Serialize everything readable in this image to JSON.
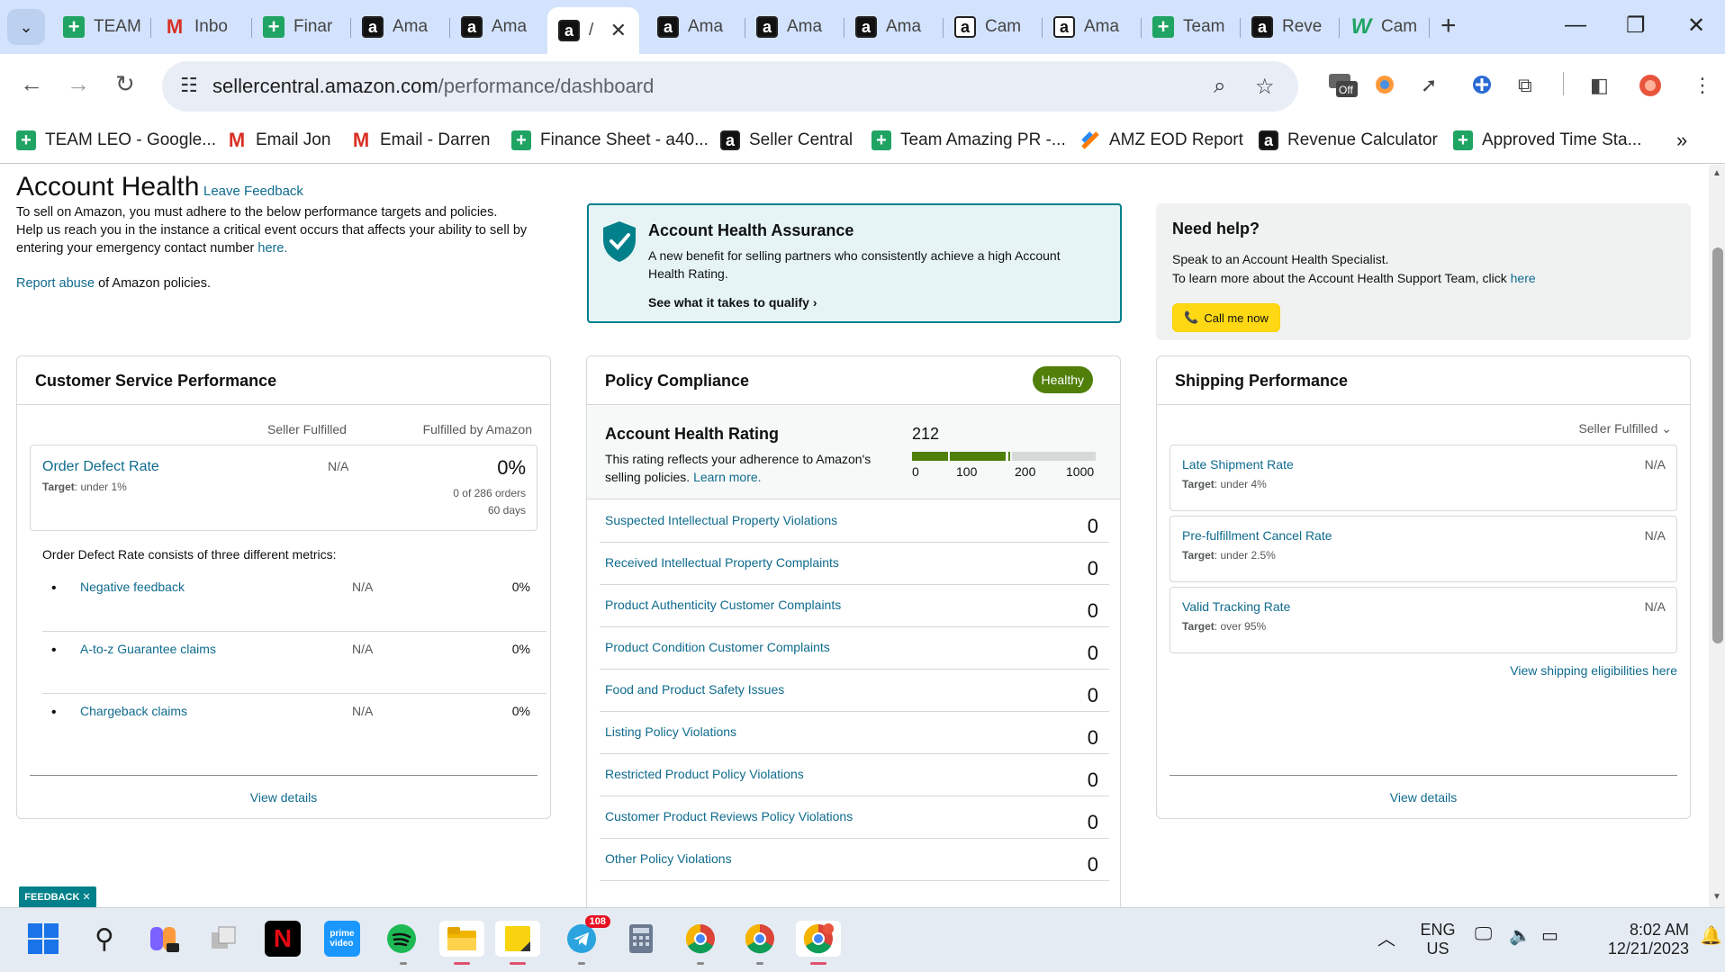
{
  "tabs": [
    {
      "label": "TEAM",
      "icon": "sheets-icon"
    },
    {
      "label": "Inbo",
      "icon": "gmail-icon"
    },
    {
      "label": "Finar",
      "icon": "sheets-icon"
    },
    {
      "label": "Ama",
      "icon": "amazon-icon"
    },
    {
      "label": "Ama",
      "icon": "amazon-icon"
    },
    {
      "label": "/",
      "icon": "amazon-icon",
      "active": true
    },
    {
      "label": "Ama",
      "icon": "amazon-icon"
    },
    {
      "label": "Ama",
      "icon": "amazon-icon"
    },
    {
      "label": "Ama",
      "icon": "amazon-icon"
    },
    {
      "label": "Cam",
      "icon": "amazon-icon"
    },
    {
      "label": "Ama",
      "icon": "amazon-icon"
    },
    {
      "label": "Team",
      "icon": "sheets-icon"
    },
    {
      "label": "Reve",
      "icon": "amazon-icon"
    },
    {
      "label": "Cam",
      "icon": "w-icon"
    }
  ],
  "toolbar": {
    "url_host": "sellercentral.amazon.com",
    "url_path": "/performance/dashboard",
    "extension_badge": "Off"
  },
  "bookmarks": [
    {
      "label": "TEAM LEO - Google...",
      "icon": "sheets-icon"
    },
    {
      "label": "Email Jon",
      "icon": "gmail-icon"
    },
    {
      "label": "Email - Darren",
      "icon": "gmail-icon"
    },
    {
      "label": "Finance Sheet - a40...",
      "icon": "sheets-icon"
    },
    {
      "label": "Seller Central",
      "icon": "amazon-icon"
    },
    {
      "label": "Team Amazing PR -...",
      "icon": "sheets-icon"
    },
    {
      "label": "AMZ EOD Report",
      "icon": "eod-icon"
    },
    {
      "label": "Revenue Calculator",
      "icon": "amazon-icon"
    },
    {
      "label": "Approved Time Sta...",
      "icon": "sheets-icon"
    }
  ],
  "header": {
    "title": "Account Health",
    "leave_feedback": "Leave Feedback",
    "intro_1": "To sell on Amazon, you must adhere to the below performance targets and policies.",
    "intro_2": "Help us reach you in the instance a critical event occurs that affects your ability to sell by entering your emergency contact number ",
    "intro_here": "here.",
    "report_link": "Report abuse",
    "report_rest": " of Amazon policies."
  },
  "assurance": {
    "title": "Account Health Assurance",
    "text": "A new benefit for selling partners who consistently achieve a high Account Health Rating.",
    "cta": "See what it takes to qualify"
  },
  "help": {
    "title": "Need help?",
    "line1": "Speak to an Account Health Specialist.",
    "line2": "To learn more about the Account Health Support Team, click ",
    "here": "here",
    "call_button": "Call me now"
  },
  "customer_service": {
    "title": "Customer Service Performance",
    "col_seller": "Seller Fulfilled",
    "col_fba": "Fulfilled by Amazon",
    "odr_name": "Order Defect Rate",
    "odr_target_label": "Target",
    "odr_target": ": under 1%",
    "odr_seller": "N/A",
    "odr_fba": "0%",
    "odr_orders": "0 of 286 orders",
    "odr_days": "60 days",
    "odr_desc": "Order Defect Rate consists of three different metrics:",
    "metrics": [
      {
        "name": "Negative feedback",
        "seller": "N/A",
        "fba": "0%"
      },
      {
        "name": "A-to-z Guarantee claims",
        "seller": "N/A",
        "fba": "0%"
      },
      {
        "name": "Chargeback claims",
        "seller": "N/A",
        "fba": "0%"
      }
    ],
    "view_details": "View details"
  },
  "policy": {
    "title": "Policy Compliance",
    "status": "Healthy",
    "rating_title": "Account Health Rating",
    "rating_text": "This rating reflects your adherence to Amazon's selling policies. ",
    "learn_more": "Learn more.",
    "score": "212",
    "score_value": 212,
    "scale_labels": [
      "0",
      "100",
      "200",
      "1000"
    ],
    "violations": [
      {
        "name": "Suspected Intellectual Property Violations",
        "count": "0"
      },
      {
        "name": "Received Intellectual Property Complaints",
        "count": "0"
      },
      {
        "name": "Product Authenticity Customer Complaints",
        "count": "0"
      },
      {
        "name": "Product Condition Customer Complaints",
        "count": "0"
      },
      {
        "name": "Food and Product Safety Issues",
        "count": "0"
      },
      {
        "name": "Listing Policy Violations",
        "count": "0"
      },
      {
        "name": "Restricted Product Policy Violations",
        "count": "0"
      },
      {
        "name": "Customer Product Reviews Policy Violations",
        "count": "0"
      },
      {
        "name": "Other Policy Violations",
        "count": "0"
      }
    ]
  },
  "shipping": {
    "title": "Shipping Performance",
    "filter": "Seller Fulfilled",
    "metrics": [
      {
        "name": "Late Shipment Rate",
        "target_label": "Target",
        "target": ": under 4%",
        "value": "N/A"
      },
      {
        "name": "Pre-fulfillment Cancel Rate",
        "target_label": "Target",
        "target": ": under 2.5%",
        "value": "N/A"
      },
      {
        "name": "Valid Tracking Rate",
        "target_label": "Target",
        "target": ": over 95%",
        "value": "N/A"
      }
    ],
    "eligibilities_link": "View shipping eligibilities here",
    "view_details": "View details"
  },
  "feedback_tab": "FEEDBACK ✕",
  "taskbar": {
    "telegram_badge": "108",
    "lang1": "ENG",
    "lang2": "US",
    "time": "8:02 AM",
    "date": "12/21/2023"
  },
  "colors": {
    "link": "#0f6b8e",
    "healthy_badge": "#507f0a",
    "assurance_border": "#00808a",
    "call_button": "#ffd814",
    "tabstrip": "#d3e3fd"
  }
}
